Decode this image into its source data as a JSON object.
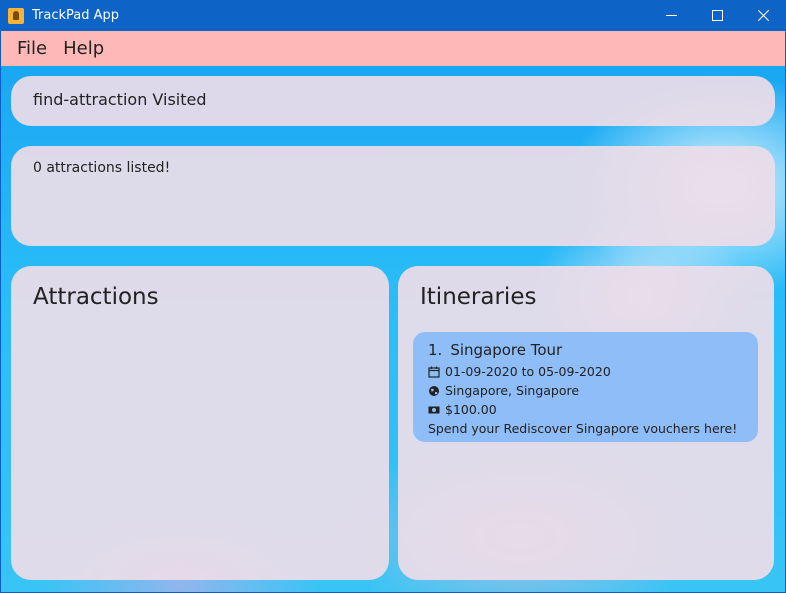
{
  "window": {
    "title": "TrackPad App",
    "minimize_glyph": "—",
    "maximize_glyph": "☐",
    "close_glyph": "✕"
  },
  "menu": {
    "items": [
      "File",
      "Help"
    ]
  },
  "command": {
    "value": "find-attraction Visited"
  },
  "result": {
    "message": "0 attractions listed!"
  },
  "attractions": {
    "title": "Attractions",
    "items": []
  },
  "itineraries": {
    "title": "Itineraries",
    "items": [
      {
        "index": "1.",
        "name": "Singapore Tour",
        "dates": "01-09-2020 to 05-09-2020",
        "location": "Singapore, Singapore",
        "price": "$100.00",
        "description": "Spend your Rediscover Singapore vouchers here!"
      }
    ]
  },
  "colors": {
    "titlebar": "#0d63c6",
    "menubar": "#ffb8b8",
    "panel": "#ecdde8",
    "card": "#8ebdf7"
  }
}
